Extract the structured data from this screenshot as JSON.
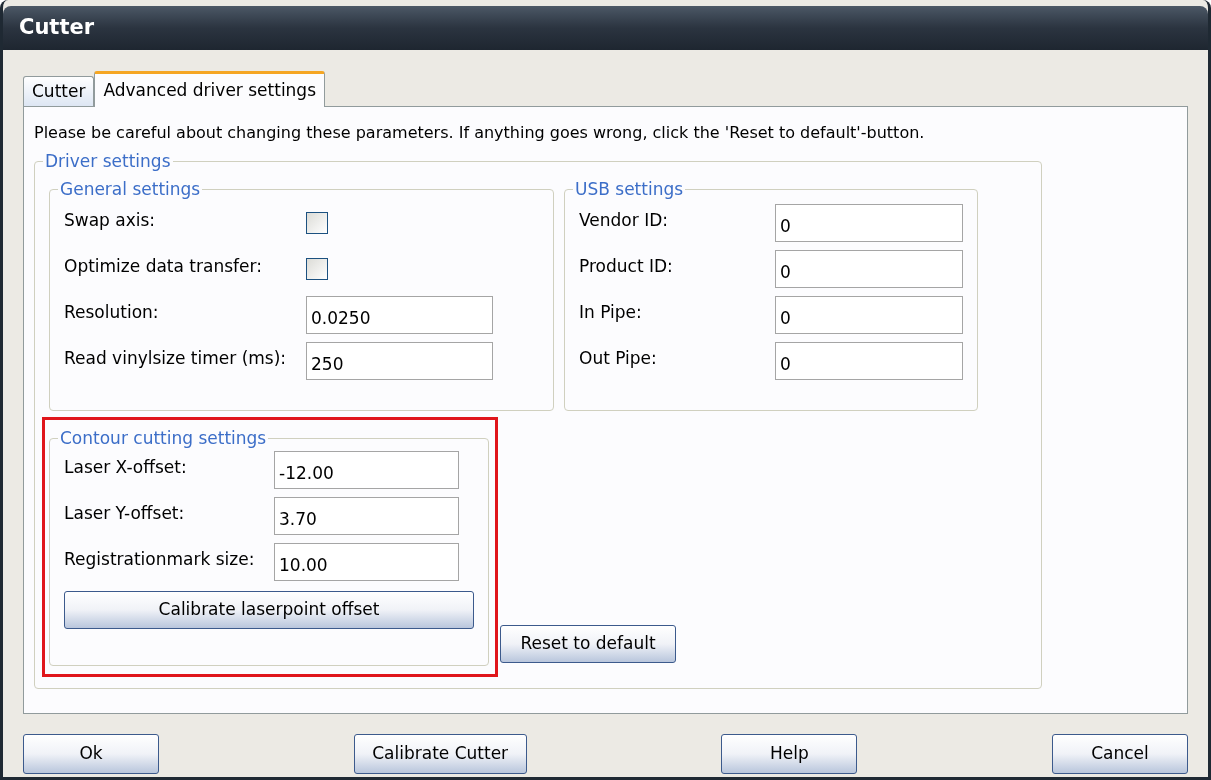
{
  "window": {
    "title": "Cutter"
  },
  "tabs": [
    {
      "label": "Cutter",
      "selected": false
    },
    {
      "label": "Advanced driver settings",
      "selected": true
    }
  ],
  "notice": "Please be careful about changing these parameters. If anything goes wrong, click the 'Reset to default'-button.",
  "driver_settings": {
    "title": "Driver settings",
    "general": {
      "title": "General settings",
      "rows": [
        {
          "kind": "checkbox",
          "label": "Swap axis:",
          "checked": false
        },
        {
          "kind": "checkbox",
          "label": "Optimize data transfer:",
          "checked": false
        },
        {
          "kind": "input",
          "label": "Resolution:",
          "value": "0.0250"
        },
        {
          "kind": "input",
          "label": "Read vinylsize timer (ms):",
          "value": "250"
        }
      ]
    },
    "usb": {
      "title": "USB settings",
      "rows": [
        {
          "kind": "input",
          "label": "Vendor ID:",
          "value": "0"
        },
        {
          "kind": "input",
          "label": "Product ID:",
          "value": "0"
        },
        {
          "kind": "input",
          "label": "In Pipe:",
          "value": "0"
        },
        {
          "kind": "input",
          "label": "Out Pipe:",
          "value": "0"
        }
      ]
    },
    "contour": {
      "title": "Contour cutting settings",
      "highlighted": true,
      "rows": [
        {
          "kind": "input",
          "label": "Laser X-offset:",
          "value": "-12.00"
        },
        {
          "kind": "input",
          "label": "Laser Y-offset:",
          "value": "3.70"
        },
        {
          "kind": "input",
          "label": "Registrationmark size:",
          "value": "10.00"
        }
      ],
      "button": "Calibrate laserpoint offset"
    },
    "reset_button": "Reset to default"
  },
  "buttons": [
    "Ok",
    "Calibrate Cutter",
    "Help",
    "Cancel"
  ]
}
